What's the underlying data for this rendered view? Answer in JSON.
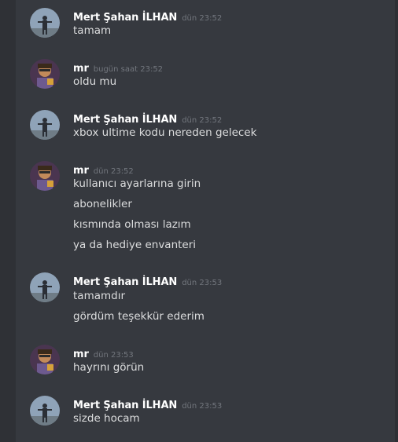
{
  "users": {
    "mert": {
      "name": "Mert Şahan İLHAN",
      "avatar_icon": "silhouette-avatar-icon"
    },
    "mr": {
      "name": "mr",
      "avatar_icon": "illustrated-avatar-icon"
    }
  },
  "messages": [
    {
      "user": "Mert Şahan İLHAN",
      "time": "dün 23:52",
      "lines": [
        "tamam"
      ]
    },
    {
      "user": "mr",
      "time": "bugün saat 23:52",
      "lines": [
        "oldu mu"
      ]
    },
    {
      "user": "Mert Şahan İLHAN",
      "time": "dün 23:52",
      "lines": [
        "xbox ultime kodu nereden gelecek"
      ]
    },
    {
      "user": "mr",
      "time": "dün 23:52",
      "lines": [
        "kullanıcı ayarlarına girin",
        "abonelikler",
        "kısmında olması lazım",
        "ya da hediye envanteri"
      ]
    },
    {
      "user": "Mert Şahan İLHAN",
      "time": "dün 23:53",
      "lines": [
        "tamamdır",
        "gördüm teşekkür ederim"
      ]
    },
    {
      "user": "mr",
      "time": "dün 23:53",
      "lines": [
        "hayrını görün"
      ]
    },
    {
      "user": "Mert Şahan İLHAN",
      "time": "dün 23:53",
      "lines": [
        "sizde hocam"
      ]
    }
  ]
}
